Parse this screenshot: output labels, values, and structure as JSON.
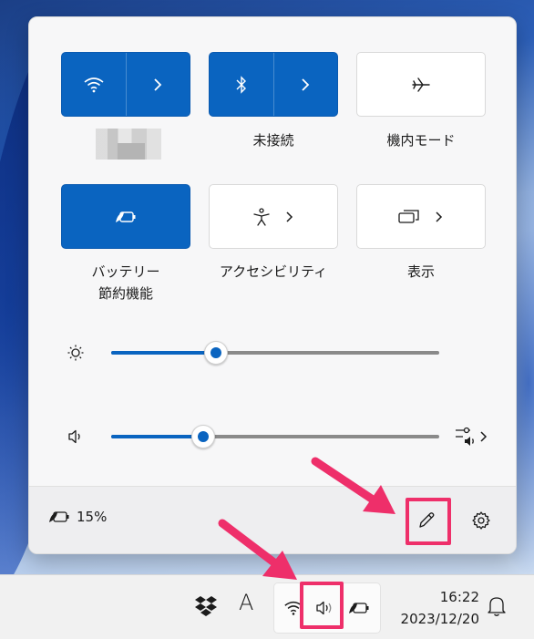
{
  "tiles": {
    "wifi": {
      "label": ""
    },
    "bluetooth": {
      "label": "未接続"
    },
    "airplane": {
      "label": "機内モード"
    },
    "battery_saver": {
      "label_line1": "バッテリー",
      "label_line2": "節約機能"
    },
    "accessibility": {
      "label": "アクセシビリティ"
    },
    "cast": {
      "label": "表示"
    }
  },
  "sliders": {
    "brightness": {
      "value": 0.32
    },
    "volume": {
      "value": 0.28
    }
  },
  "footer": {
    "battery_percent": "15%"
  },
  "taskbar": {
    "ime_label": "A",
    "time": "16:22",
    "date": "2023/12/20"
  },
  "colors": {
    "accent": "#0a64c0",
    "highlight": "#ee2f6a"
  }
}
